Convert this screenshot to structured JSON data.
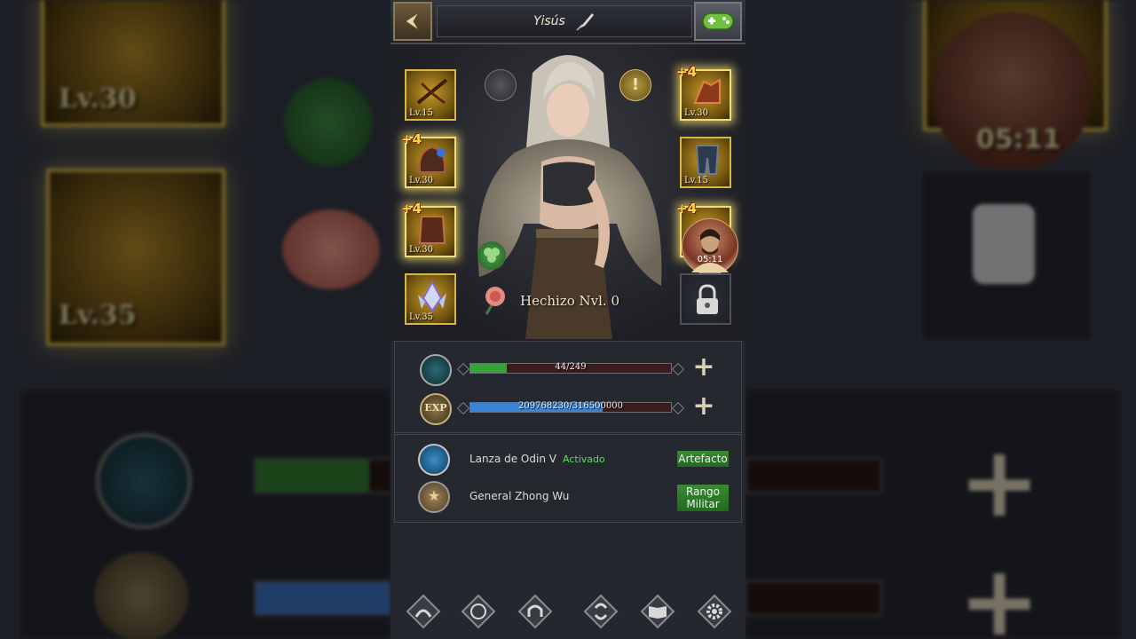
{
  "header": {
    "player_name": "Yisús",
    "icons": {
      "back": "back-arrow-icon",
      "edit": "quill-pen-icon",
      "gamepad": "gamepad-icon"
    }
  },
  "equipment": {
    "left": [
      {
        "name": "crossbow",
        "level": "Lv.15",
        "enhance": ""
      },
      {
        "name": "helmet",
        "level": "Lv.30",
        "enhance": "+4"
      },
      {
        "name": "armor",
        "level": "Lv.30",
        "enhance": "+4"
      },
      {
        "name": "crystal",
        "level": "Lv.35",
        "enhance": ""
      }
    ],
    "right": [
      {
        "name": "gauntlet",
        "level": "Lv.30",
        "enhance": "+4"
      },
      {
        "name": "greaves",
        "level": "Lv.15",
        "enhance": ""
      },
      {
        "name": "boots",
        "level": "",
        "enhance": "+4"
      },
      {
        "name": "locked-slot",
        "level": "",
        "enhance": ""
      }
    ]
  },
  "character": {
    "spell_label": "Hechizo Nvl. 0",
    "video_timer": "05:11",
    "icons": {
      "camp": "camp-icon",
      "alert": "exclamation-icon",
      "clover": "clover-icon",
      "rose": "rose-icon"
    }
  },
  "stats": {
    "troops": {
      "text": "44/249",
      "fraction": 0.18,
      "color": "#37a23a"
    },
    "exp": {
      "text": "209768230/316500000",
      "fraction": 0.66,
      "color": "#3b83d6"
    }
  },
  "info": {
    "artifact": {
      "name": "Lanza de Odin V",
      "status": "Activado",
      "button": "Artefacto"
    },
    "rank": {
      "name": "General Zhong Wu",
      "button": "Rango Militar"
    }
  },
  "nav": [
    "hero-icon",
    "medal-icon",
    "helmet-icon",
    "swap-icon",
    "book-icon",
    "settings-icon"
  ],
  "colors": {
    "gold": "#d7b648",
    "accent_green": "#2f7d2a"
  }
}
